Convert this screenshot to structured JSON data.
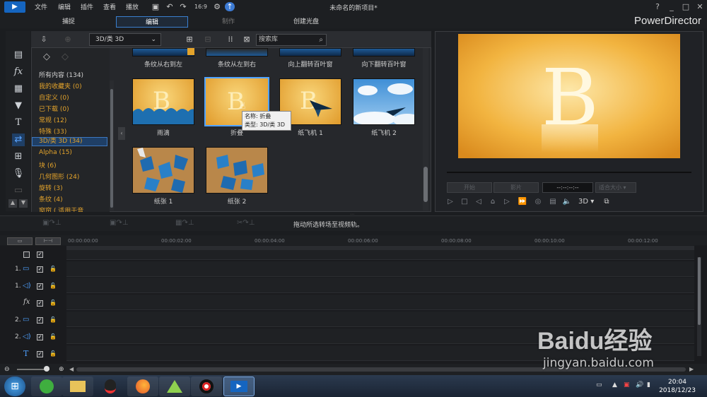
{
  "menubar": {
    "items": [
      "文件",
      "编辑",
      "插件",
      "查看",
      "播放"
    ],
    "title": "未命名的新项目*",
    "window_buttons": [
      "?",
      "_",
      "□",
      "✕"
    ]
  },
  "tabs": [
    {
      "label": "捕捉"
    },
    {
      "label": "编辑"
    },
    {
      "label": "制作"
    },
    {
      "label": "创建光盘"
    }
  ],
  "brand": "PowerDirector",
  "library": {
    "category_select": "3D/类 3D",
    "search_placeholder": "搜索库",
    "categories": [
      "所有内容 (134)",
      "我的收藏夹 (0)",
      "自定义 (0)",
      "已下载 (0)",
      "常规 (12)",
      "特殊 (33)",
      "3D/类 3D (34)",
      "Alpha (15)",
      "块 (6)",
      "几何图形 (24)",
      "旋转 (3)",
      "条纹 (4)",
      "窗帘 ( 适用于音"
    ],
    "top_row": [
      "条纹从右到左",
      "条纹从左到右",
      "向上翻转百叶窗",
      "向下翻转百叶窗"
    ],
    "row2": [
      "雨滴",
      "折叠",
      "纸飞机 1",
      "纸飞机 2"
    ],
    "row3": [
      "纸张 1",
      "纸张 2"
    ],
    "tooltip": {
      "name": "名称: 折叠",
      "type": "类型: 3D/类 3D"
    }
  },
  "preview": {
    "letter": "B",
    "btn1": "开始",
    "btn2": "影片",
    "timecode": "--:--:--:--",
    "size": "适合大小",
    "mode": "3D"
  },
  "hint": "拖动所选转场至视频轨。",
  "ruler": [
    "00:00:00:00",
    "00:00:02:00",
    "00:00:04:00",
    "00:00:06:00",
    "00:00:08:00",
    "00:00:10:00",
    "00:00:12:00"
  ],
  "tracks": [
    "1.",
    "1.",
    "fx",
    "2.",
    "2.",
    "T"
  ],
  "taskbar": {
    "time": "20:04",
    "date": "2018/12/23"
  },
  "watermark": {
    "text": "Baidu经验",
    "url": "jingyan.baidu.com"
  }
}
